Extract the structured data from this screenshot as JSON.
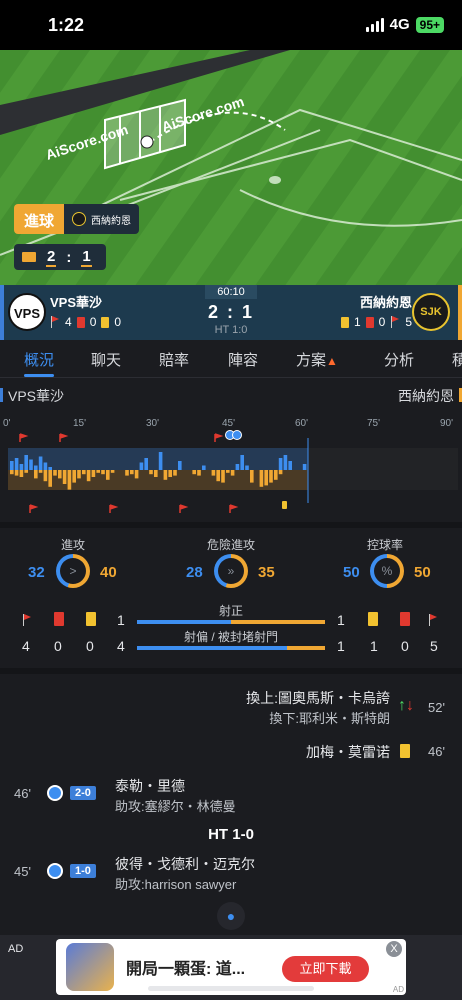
{
  "status_bar": {
    "time": "1:22",
    "network": "4G",
    "battery": "95+"
  },
  "animation": {
    "watermark1": "AiScore.com",
    "watermark2": "AiScore.com",
    "event_label": "進球",
    "event_team": "西納約恩",
    "score_home": "2",
    "score_sep": ":",
    "score_away": "1"
  },
  "match": {
    "clock": "60:10",
    "score": "2 : 1",
    "ht": "HT 1:0",
    "home": {
      "name": "VPS華沙",
      "corners": "4",
      "red": "0",
      "yellow": "0"
    },
    "away": {
      "name": "西納約恩",
      "corners": "5",
      "red": "0",
      "yellow": "1"
    },
    "colors": {
      "home": "#3d7fd9",
      "away": "#f0a733"
    }
  },
  "tabs": [
    {
      "label": "概況"
    },
    {
      "label": "聊天"
    },
    {
      "label": "賠率"
    },
    {
      "label": "陣容"
    },
    {
      "label": "方案"
    },
    {
      "label": "分析"
    },
    {
      "label": "積"
    }
  ],
  "momentum": {
    "home_label": "VPS華沙",
    "away_label": "西納約恩",
    "ticks": [
      "0'",
      "15'",
      "30'",
      "45'",
      "60'",
      "75'",
      "90'"
    ]
  },
  "stats": {
    "attack": {
      "label": "進攻",
      "home": "32",
      "away": "40"
    },
    "dangerous": {
      "label": "危險進攻",
      "home": "28",
      "away": "35"
    },
    "possession": {
      "label": "控球率",
      "home": "50",
      "away": "50"
    },
    "shots_on": {
      "label": "射正",
      "home": "1",
      "away": "1"
    },
    "shots_off": {
      "label": "射偏 / 被封堵射門",
      "home": "4",
      "away": "1"
    },
    "home_counts": {
      "corners": "4",
      "red": "0",
      "yellow": "0"
    },
    "away_counts": {
      "yellow": "1",
      "red": "0",
      "corners": "5"
    }
  },
  "events": {
    "sub": {
      "in": "換上:圖奧馬斯・卡烏誇",
      "out": "換下:耶利米・斯特朗",
      "minute": "52'"
    },
    "yellow": {
      "player": "加梅・莫雷诺",
      "minute": "46'"
    },
    "goal2": {
      "minute": "46'",
      "score": "2-0",
      "player": "泰勒・里德",
      "assist": "助攻:塞繆尔・林德曼"
    },
    "ht": "HT 1-0",
    "goal1": {
      "minute": "45'",
      "score": "1-0",
      "player": "彼得・戈德利・迈克尔",
      "assist": "助攻:harrison sawyer"
    }
  },
  "ad": {
    "tag": "AD",
    "title": "開局一顆蛋: 道...",
    "button": "立即下載",
    "close": "X",
    "small": "AD"
  }
}
